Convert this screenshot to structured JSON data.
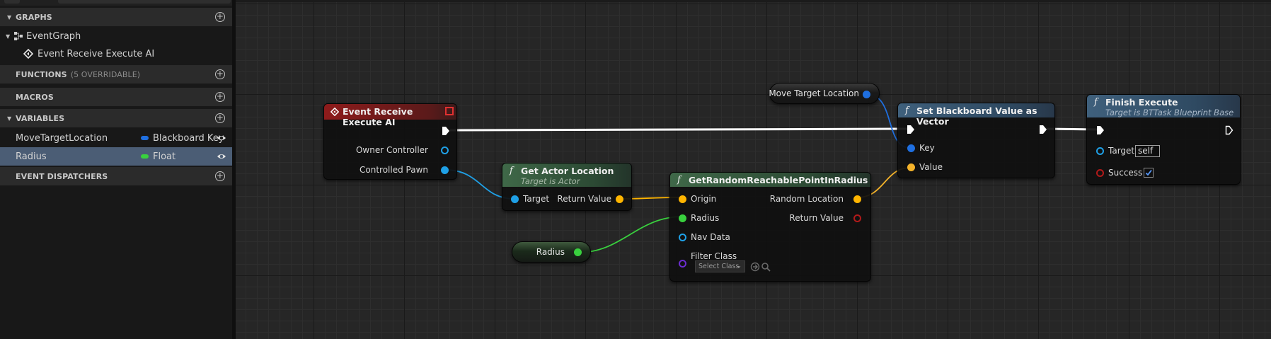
{
  "panel": {
    "graphs": {
      "title": "GRAPHS",
      "items": [
        {
          "label": "EventGraph"
        },
        {
          "label": "Event Receive Execute AI"
        }
      ]
    },
    "functions": {
      "title": "FUNCTIONS",
      "note": "(5 OVERRIDABLE)"
    },
    "macros": {
      "title": "MACROS"
    },
    "variables": {
      "title": "VARIABLES",
      "items": [
        {
          "name": "MoveTargetLocation",
          "type": "Blackboard Key",
          "color": "#1f6fe0"
        },
        {
          "name": "Radius",
          "type": "Float",
          "color": "#39d13e"
        }
      ]
    },
    "dispatchers": {
      "title": "EVENT DISPATCHERS"
    }
  },
  "colors": {
    "exec": "#ffffff",
    "object": "#1fa0e6",
    "struct": "#ffb500",
    "vector": "#f4b32a",
    "float": "#39d13e",
    "bool": "#b11a1a",
    "class": "#6b2dcf",
    "selection": "#4b5d75"
  },
  "nodes": {
    "event": {
      "title": "Event Receive Execute AI",
      "pins": {
        "owner": "Owner Controller",
        "pawn": "Controlled Pawn"
      }
    },
    "actor_location": {
      "title": "Get Actor Location",
      "subtitle": "Target is Actor",
      "pins": {
        "target": "Target",
        "ret": "Return Value"
      }
    },
    "random_point": {
      "title": "GetRandomReachablePointInRadius",
      "pins": {
        "origin": "Origin",
        "radius": "Radius",
        "navdata": "Nav Data",
        "filter": "Filter Class",
        "filter_value": "Select Class",
        "random": "Random Location",
        "ret": "Return Value"
      }
    },
    "radius_var": {
      "label": "Radius"
    },
    "move_target_var": {
      "label": "Move Target Location"
    },
    "set_bb": {
      "title": "Set Blackboard Value as Vector",
      "pins": {
        "key": "Key",
        "value": "Value"
      }
    },
    "finish": {
      "title": "Finish Execute",
      "subtitle": "Target is BTTask Blueprint Base",
      "pins": {
        "target": "Target",
        "target_value": "self",
        "success": "Success"
      }
    }
  }
}
